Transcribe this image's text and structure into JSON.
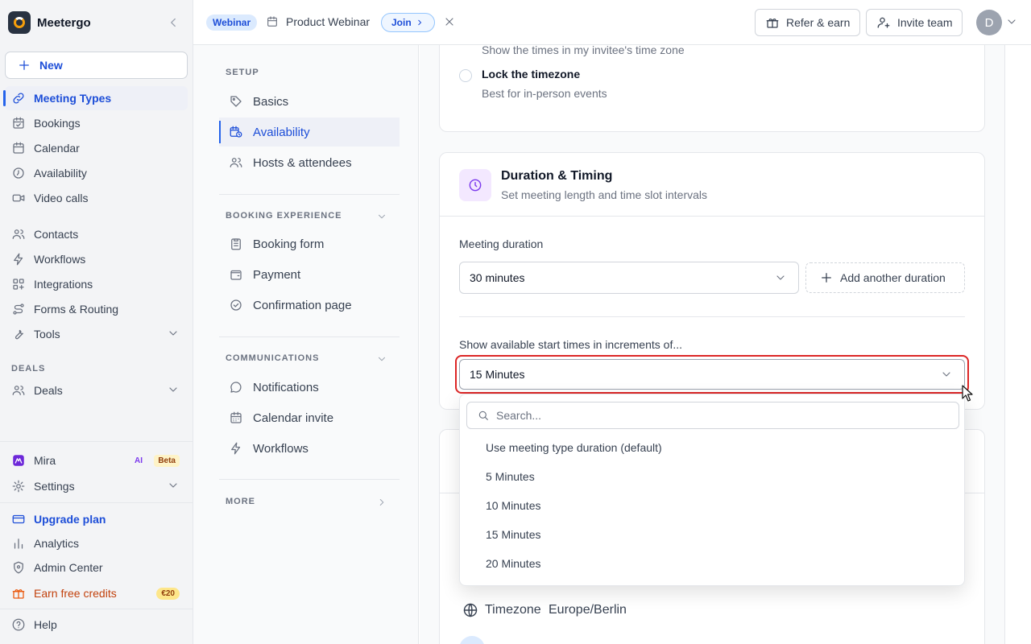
{
  "app": {
    "name": "Meetergo"
  },
  "sidebar": {
    "new_label": "New",
    "items": [
      {
        "label": "Meeting Types"
      },
      {
        "label": "Bookings"
      },
      {
        "label": "Calendar"
      },
      {
        "label": "Availability"
      },
      {
        "label": "Video calls"
      },
      {
        "label": "Contacts"
      },
      {
        "label": "Workflows"
      },
      {
        "label": "Integrations"
      },
      {
        "label": "Forms & Routing"
      },
      {
        "label": "Tools"
      }
    ],
    "deals_section": "DEALS",
    "deals_label": "Deals",
    "mira": {
      "label": "Mira",
      "ai_badge": "AI",
      "beta_badge": "Beta"
    },
    "settings_label": "Settings",
    "upgrade_label": "Upgrade plan",
    "analytics_label": "Analytics",
    "admin_label": "Admin Center",
    "credits": {
      "label": "Earn free credits",
      "badge": "€20"
    },
    "help_label": "Help"
  },
  "topbar": {
    "tag": "Webinar",
    "title": "Product Webinar",
    "join_label": "Join",
    "refer_label": "Refer & earn",
    "invite_label": "Invite team",
    "avatar_initial": "D"
  },
  "subnav": {
    "setup_label": "SETUP",
    "setup_items": [
      {
        "label": "Basics"
      },
      {
        "label": "Availability"
      },
      {
        "label": "Hosts & attendees"
      }
    ],
    "booking_label": "BOOKING EXPERIENCE",
    "booking_items": [
      {
        "label": "Booking form"
      },
      {
        "label": "Payment"
      },
      {
        "label": "Confirmation page"
      }
    ],
    "comms_label": "COMMUNICATIONS",
    "comms_items": [
      {
        "label": "Notifications"
      },
      {
        "label": "Calendar invite"
      },
      {
        "label": "Workflows"
      }
    ],
    "more_label": "MORE"
  },
  "main": {
    "timezone_card": {
      "invitee_desc": "Show the times in my invitee's time zone",
      "lock_title": "Lock the timezone",
      "lock_desc": "Best for in-person events"
    },
    "duration_card": {
      "title": "Duration & Timing",
      "subtitle": "Set meeting length and time slot intervals",
      "duration_label": "Meeting duration",
      "duration_value": "30 minutes",
      "add_duration_label": "Add another duration",
      "increments_label": "Show available start times in increments of...",
      "increments_value": "15 Minutes"
    },
    "timezone_row": {
      "label": "Timezone",
      "value": "Europe/Berlin"
    }
  },
  "popover": {
    "search_placeholder": "Search...",
    "options": [
      {
        "label": "Use meeting type duration (default)"
      },
      {
        "label": "5 Minutes"
      },
      {
        "label": "10 Minutes"
      },
      {
        "label": "15 Minutes"
      },
      {
        "label": "20 Minutes"
      }
    ]
  },
  "colors": {
    "accent": "#1d4ed8",
    "focus_ring": "#dc2626",
    "sidebar_bg": "#f3f4f6"
  }
}
